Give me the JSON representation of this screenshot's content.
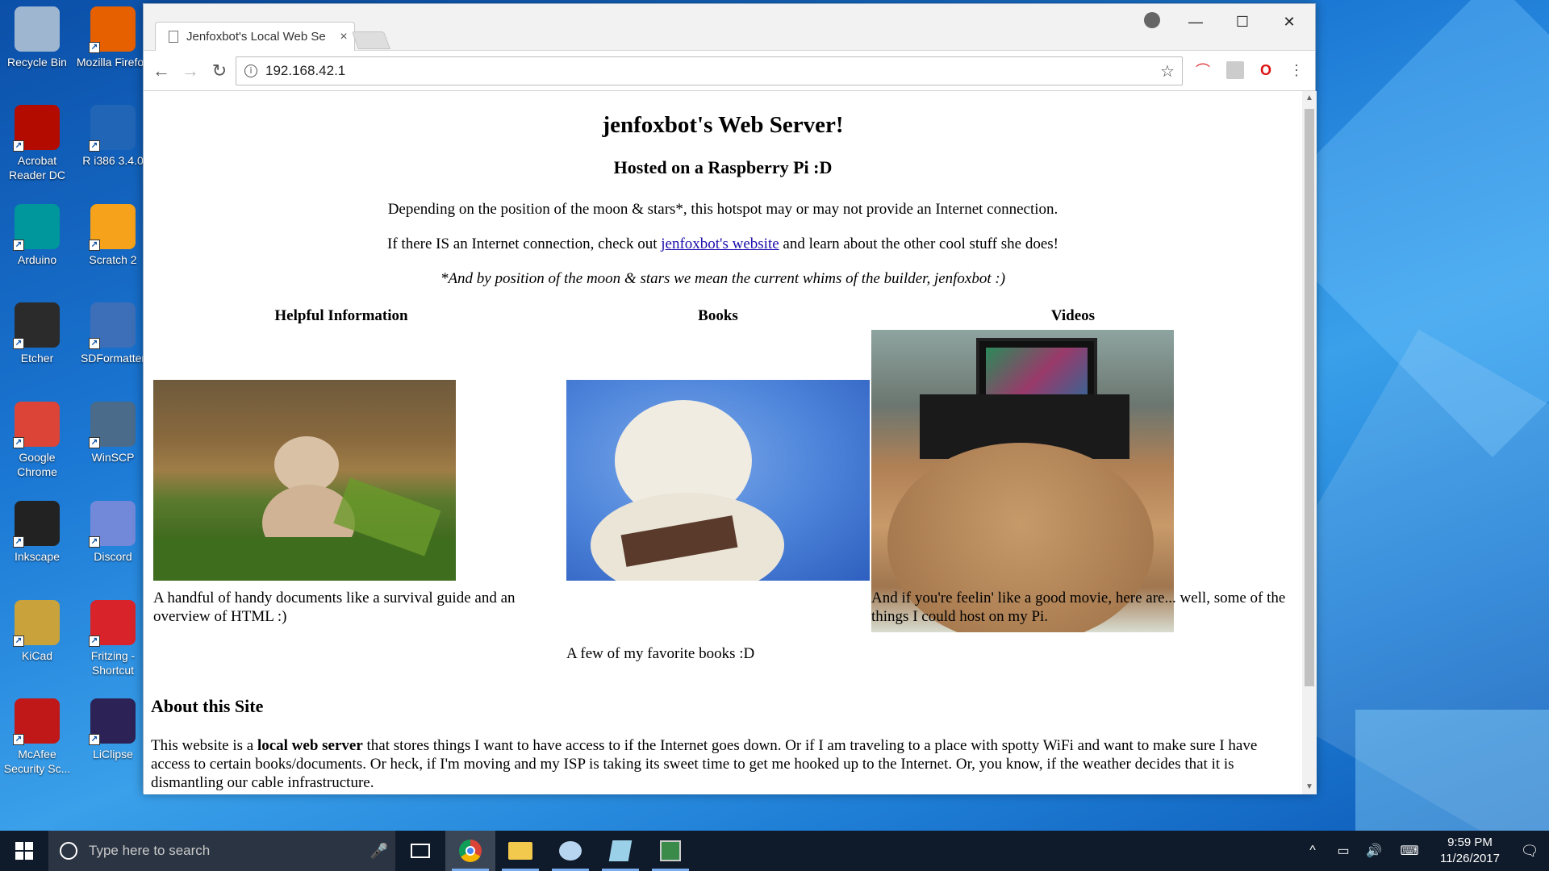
{
  "desktop": {
    "icons": [
      {
        "label": "Recycle Bin",
        "icon": "recycle-bin-icon",
        "color": "#9fb6d1"
      },
      {
        "label": "Mozilla Firefox",
        "icon": "firefox-icon",
        "color": "#e66000"
      },
      {
        "label": "Acrobat Reader DC",
        "icon": "acrobat-icon",
        "color": "#b30b00"
      },
      {
        "label": "R i386 3.4.0",
        "icon": "r-icon",
        "color": "#2165b6"
      },
      {
        "label": "Arduino",
        "icon": "arduino-icon",
        "color": "#00979c"
      },
      {
        "label": "Scratch 2",
        "icon": "scratch-icon",
        "color": "#f7a21b"
      },
      {
        "label": "Etcher",
        "icon": "etcher-icon",
        "color": "#2b2b2b"
      },
      {
        "label": "SDFormatter",
        "icon": "sdformatter-icon",
        "color": "#3d6fb8"
      },
      {
        "label": "Google Chrome",
        "icon": "chrome-icon",
        "color": "#db4437"
      },
      {
        "label": "WinSCP",
        "icon": "winscp-icon",
        "color": "#4a6b8a"
      },
      {
        "label": "Inkscape",
        "icon": "inkscape-icon",
        "color": "#222222"
      },
      {
        "label": "Discord",
        "icon": "discord-icon",
        "color": "#7289da"
      },
      {
        "label": "KiCad",
        "icon": "kicad-icon",
        "color": "#c9a23c"
      },
      {
        "label": "Fritzing - Shortcut",
        "icon": "fritzing-icon",
        "color": "#d8232a"
      },
      {
        "label": "McAfee Security Sc...",
        "icon": "mcafee-icon",
        "color": "#c01818"
      },
      {
        "label": "LiClipse",
        "icon": "liclipse-icon",
        "color": "#2c2255"
      }
    ]
  },
  "browser": {
    "tab_title": "Jenfoxbot's Local Web Se",
    "tab_close": "×",
    "url": "192.168.42.1",
    "controls": {
      "minimize": "—",
      "maximize": "☐",
      "close": "✕"
    },
    "nav": {
      "back": "←",
      "forward": "→",
      "reload": "↻"
    },
    "star": "☆",
    "menu": "⋮"
  },
  "page": {
    "title": "jenfoxbot's Web Server!",
    "subtitle": "Hosted on a Raspberry Pi :D",
    "para1": "Depending on the position of the moon & stars*, this hotspot may or may not provide an Internet connection.",
    "para2_before": "If there IS an Internet connection, check out ",
    "para2_link": "jenfoxbot's website",
    "para2_after": " and learn about the other cool stuff she does!",
    "footnote": "*And by position of the moon & stars we mean the current whims of the builder, jenfoxbot :)",
    "columns": [
      {
        "heading": "Helpful Information",
        "description": "A handful of handy documents like a survival guide and an overview of HTML :)"
      },
      {
        "heading": "Books",
        "description": "A few of my favorite books :D"
      },
      {
        "heading": "Videos",
        "description": "And if you're feelin' like a good movie, here are... well, some of the things I could host on my Pi."
      }
    ],
    "about_heading": "About this Site",
    "about_before": "This website is a ",
    "about_bold": "local web server",
    "about_after": " that stores things I want to have access to if the Internet goes down. Or if I am traveling to a place with spotty WiFi and want to make sure I have access to certain books/documents. Or heck, if I'm moving and my ISP is taking its sweet time to get me hooked up to the Internet. Or, you know, if the weather decides that it is dismantling our cable infrastructure."
  },
  "taskbar": {
    "search_placeholder": "Type here to search",
    "time": "9:59 PM",
    "date": "11/26/2017"
  }
}
